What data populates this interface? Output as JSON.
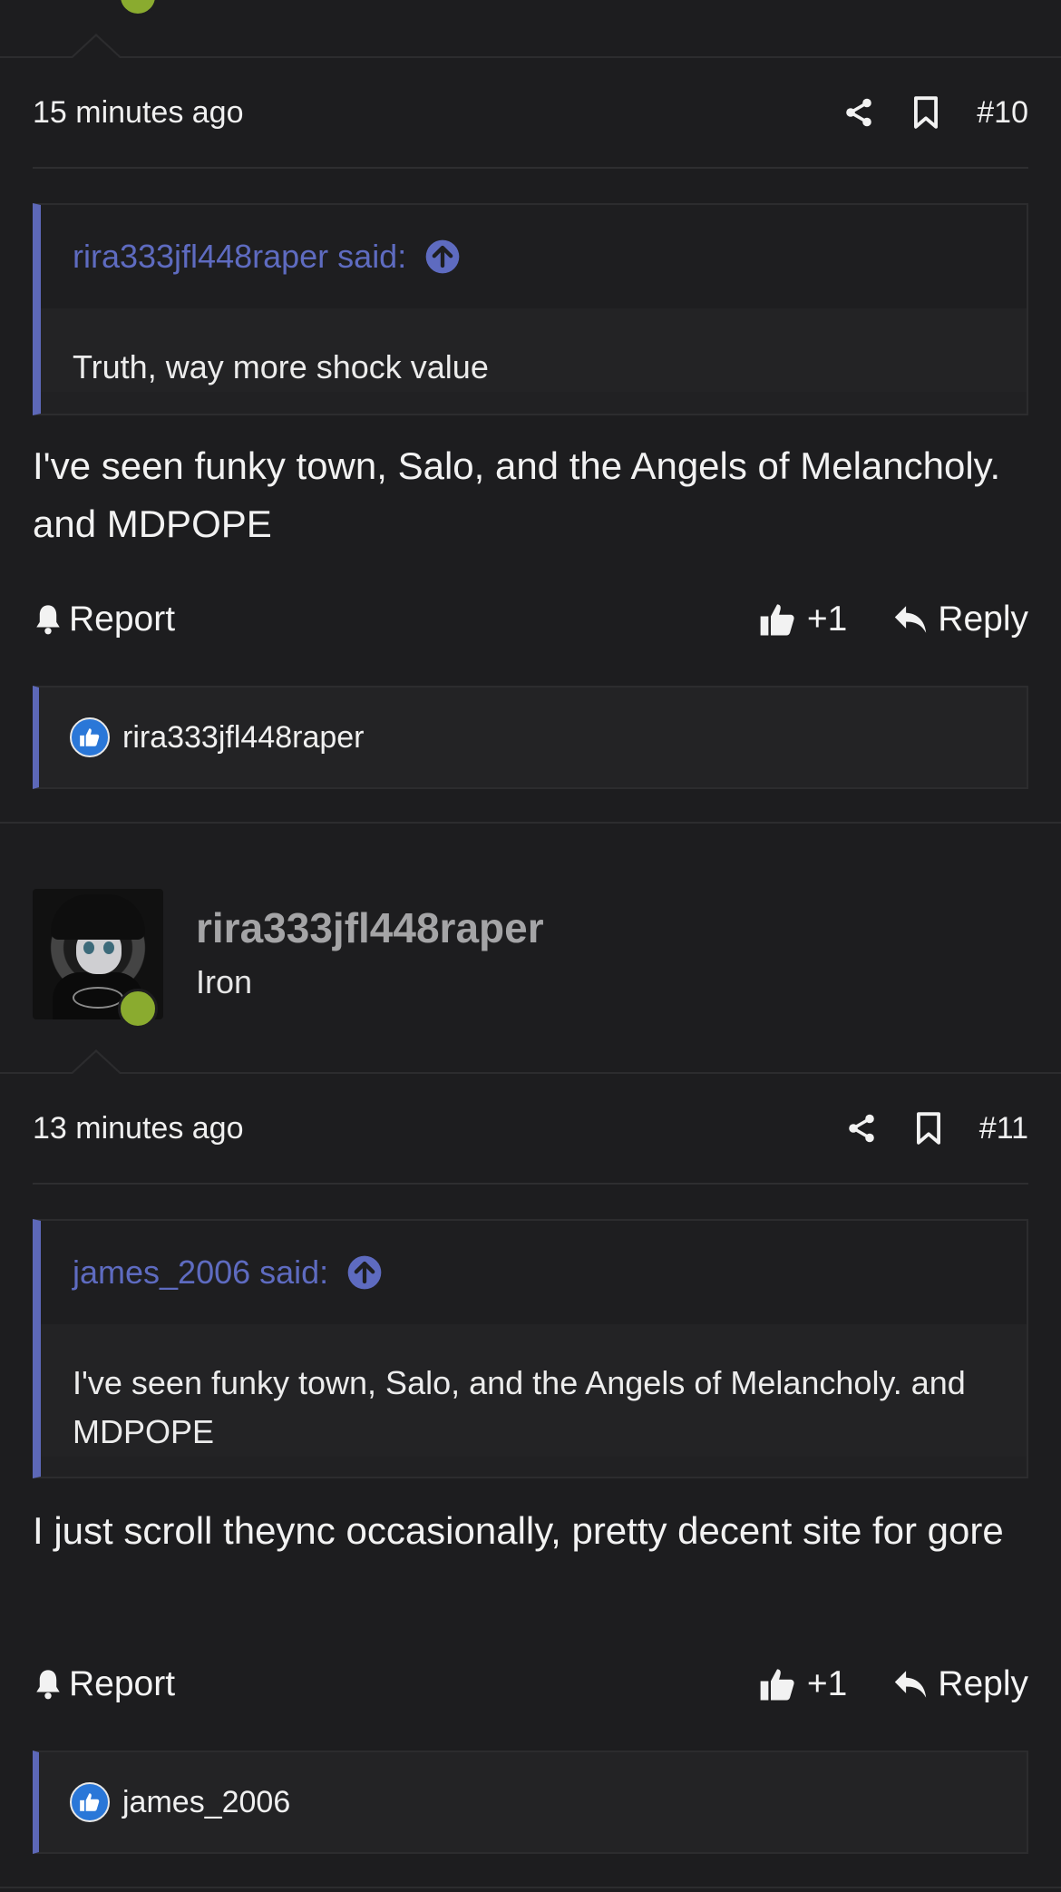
{
  "posts": [
    {
      "time": "15 minutes ago",
      "number": "#10",
      "quote": {
        "author_said": "rira333jfl448raper said:",
        "text": "Truth, way more shock value"
      },
      "message": "I've seen funky town, Salo, and the Angels of Melancholy. and MDPOPE",
      "actions": {
        "report": "Report",
        "likes": "+1",
        "reply": "Reply"
      },
      "reactions": {
        "user": "rira333jfl448raper"
      }
    },
    {
      "author": {
        "name": "rira333jfl448raper",
        "title": "Iron"
      },
      "time": "13 minutes ago",
      "number": "#11",
      "quote": {
        "author_said": "james_2006 said:",
        "text": "I've seen funky town, Salo, and the Angels of Melancholy. and MDPOPE"
      },
      "message": "I just scroll theync occasionally, pretty decent site for gore",
      "actions": {
        "report": "Report",
        "likes": "+1",
        "reply": "Reply"
      },
      "reactions": {
        "user": "james_2006"
      }
    }
  ],
  "colors": {
    "accent": "#5d68b8",
    "online": "#8aab2f",
    "like_badge": "#2a77d8",
    "background": "#1d1d1f"
  },
  "icons": [
    "share-icon",
    "bookmark-icon",
    "arrow-up-circle-icon",
    "bell-icon",
    "thumbs-up-icon",
    "reply-icon",
    "like-badge-icon"
  ]
}
